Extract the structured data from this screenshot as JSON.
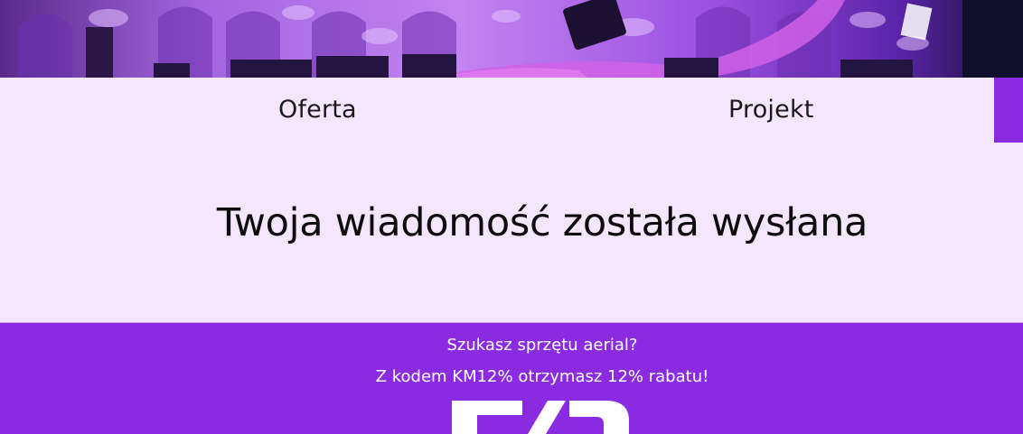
{
  "nav": {
    "items": [
      {
        "label": "Oferta"
      },
      {
        "label": "Projekt"
      }
    ]
  },
  "message": {
    "title": "Twoja wiadomość została wysłana"
  },
  "promo": {
    "question": "Szukasz sprzętu aerial?",
    "discount": "Z kodem KM12% otrzymasz 12% rabatu!",
    "logo_icon": "partner-logo"
  },
  "colors": {
    "accent": "#8a2be2",
    "background": "#f4e6fc",
    "text": "#0d0d0d",
    "promo_text": "#ffffff"
  }
}
